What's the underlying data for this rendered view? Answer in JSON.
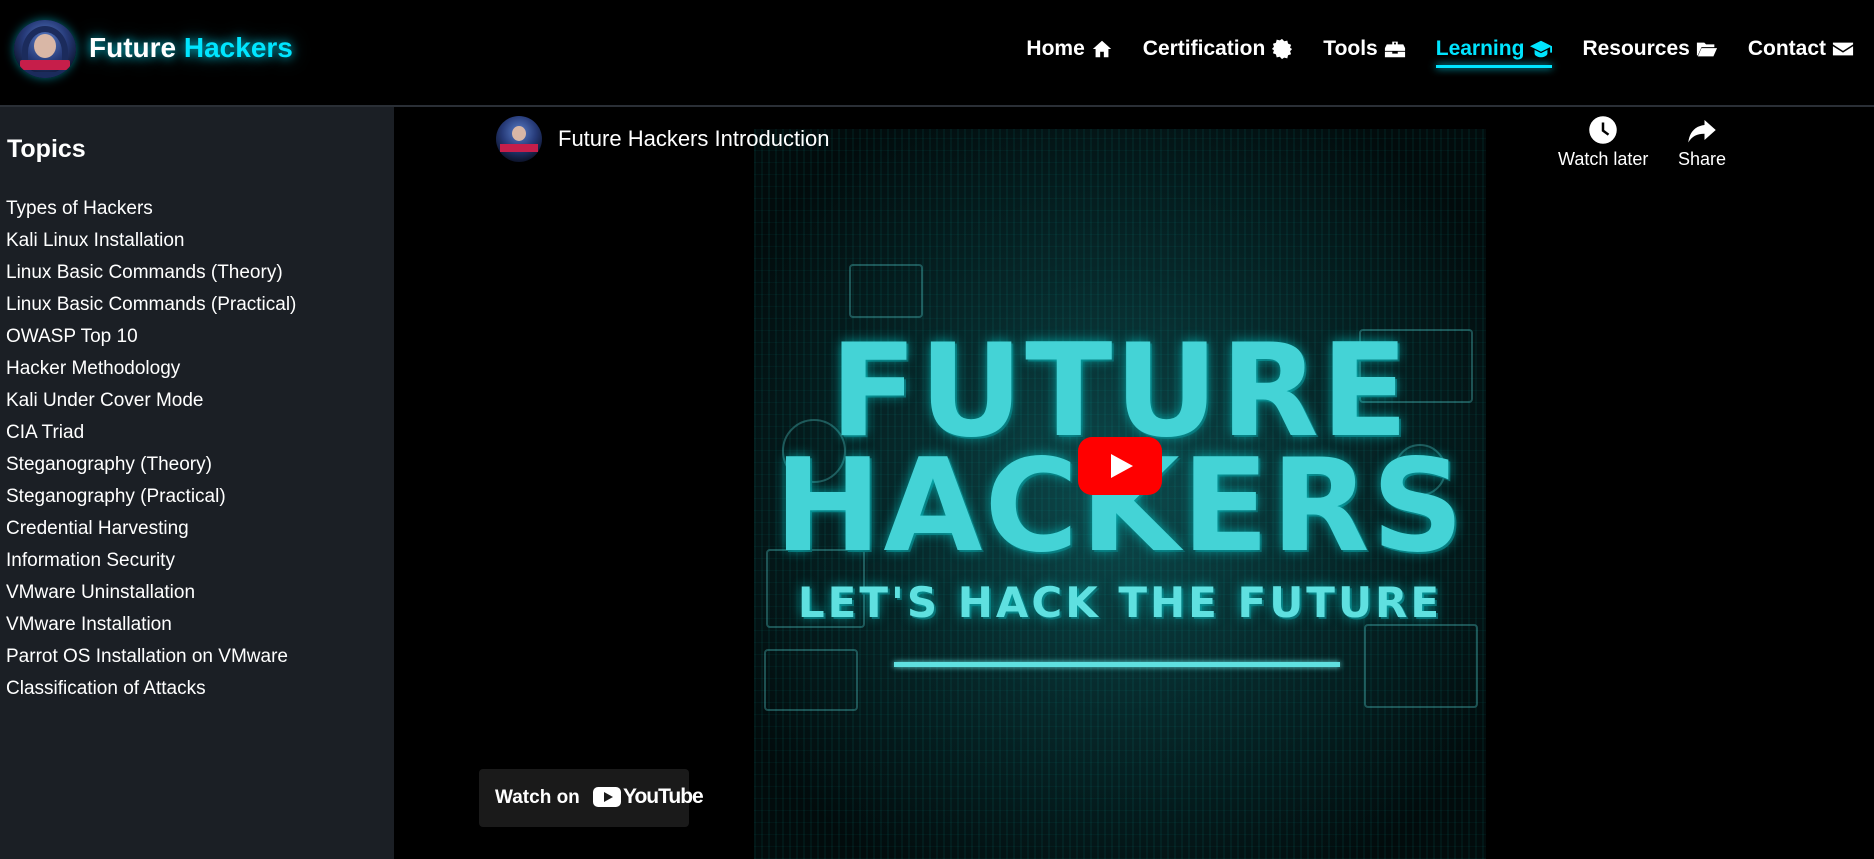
{
  "header": {
    "brand_part1": "Future",
    "brand_part2": "Hackers",
    "nav": [
      {
        "label": "Home",
        "icon": "home-icon"
      },
      {
        "label": "Certification",
        "icon": "certificate-icon"
      },
      {
        "label": "Tools",
        "icon": "toolbox-icon"
      },
      {
        "label": "Learning",
        "icon": "graduation-cap-icon",
        "active": true
      },
      {
        "label": "Resources",
        "icon": "folder-open-icon"
      },
      {
        "label": "Contact",
        "icon": "envelope-icon"
      }
    ]
  },
  "sidebar": {
    "title": "Topics",
    "topics": [
      "Types of Hackers",
      "Kali Linux Installation",
      "Linux Basic Commands (Theory)",
      "Linux Basic Commands (Practical)",
      "OWASP Top 10",
      "Hacker Methodology",
      "Kali Under Cover Mode",
      "CIA Triad",
      "Steganography (Theory)",
      "Steganography (Practical)",
      "Credential Harvesting",
      "Information Security",
      "VMware Uninstallation",
      "VMware Installation",
      "Parrot OS Installation on VMware",
      "Classification of Attacks"
    ]
  },
  "video": {
    "title": "Future Hackers Introduction",
    "watch_later": "Watch later",
    "share": "Share",
    "thumb_line1": "FUTURE",
    "thumb_line2": "HACKERS",
    "thumb_tagline": "LET'S HACK THE FUTURE",
    "watch_on": "Watch on",
    "youtube": "YouTube"
  },
  "colors": {
    "accent": "#00e5ff",
    "sidebar_bg": "#1b1f25",
    "play_red": "#ff0000"
  }
}
